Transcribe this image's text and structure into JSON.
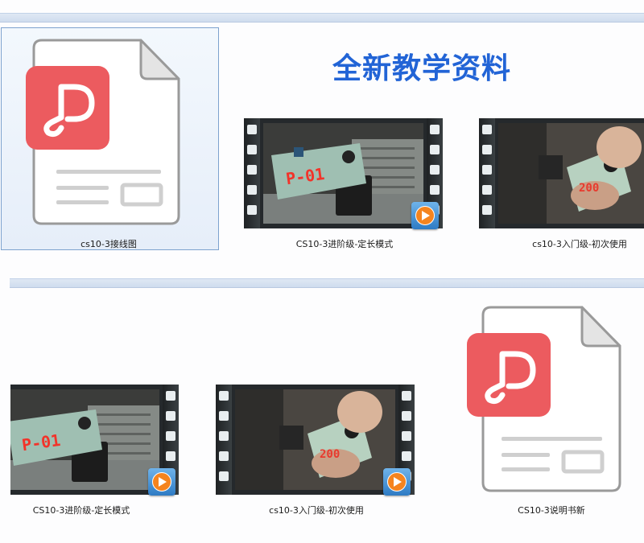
{
  "banner": {
    "title": "全新教学资料"
  },
  "row1": {
    "items": [
      {
        "label": "cs10-3接线图",
        "type": "pdf",
        "selected": true
      },
      {
        "label": "CS10-3进阶级-定长模式",
        "type": "video",
        "display": "P-01"
      },
      {
        "label": "cs10-3入门级-初次使用",
        "type": "video",
        "display": "200"
      }
    ]
  },
  "row2": {
    "items": [
      {
        "label": "CS10-3进阶级-定长模式",
        "type": "video",
        "display": "P-01"
      },
      {
        "label": "cs10-3入门级-初次使用",
        "type": "video",
        "display": "200"
      },
      {
        "label": "CS10-3说明书新",
        "type": "pdf"
      }
    ]
  },
  "colors": {
    "pdf_red": "#ec5b5f",
    "banner_blue": "#2264d6",
    "play_orange": "#f5841f"
  },
  "icons": {
    "pdf": "pdf-file-icon",
    "video": "video-file-icon",
    "play": "play-badge-icon"
  }
}
